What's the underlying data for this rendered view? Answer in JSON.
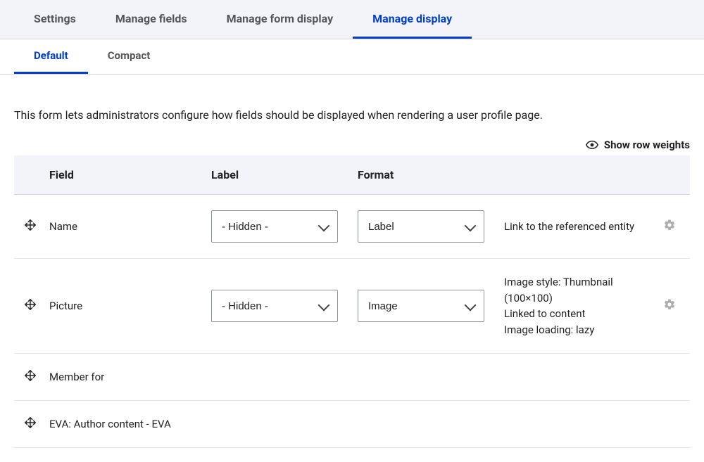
{
  "primary_tabs": [
    {
      "label": "Settings",
      "active": false
    },
    {
      "label": "Manage fields",
      "active": false
    },
    {
      "label": "Manage form display",
      "active": false
    },
    {
      "label": "Manage display",
      "active": true
    }
  ],
  "secondary_tabs": [
    {
      "label": "Default",
      "active": true
    },
    {
      "label": "Compact",
      "active": false
    }
  ],
  "description": "This form lets administrators configure how fields should be displayed when rendering a user profile page.",
  "show_row_weights": "Show row weights",
  "columns": {
    "field": "Field",
    "label": "Label",
    "format": "Format"
  },
  "rows": [
    {
      "name": "Name",
      "label_select": "- Hidden -",
      "format_select": "Label",
      "summary": [
        "Link to the referenced entity"
      ],
      "has_selects": true,
      "has_gear": true
    },
    {
      "name": "Picture",
      "label_select": "- Hidden -",
      "format_select": "Image",
      "summary": [
        "Image style: Thumbnail (100×100)",
        "Linked to content",
        "Image loading: lazy"
      ],
      "has_selects": true,
      "has_gear": true
    },
    {
      "name": "Member for",
      "has_selects": false,
      "has_gear": false
    },
    {
      "name": "EVA: Author content - EVA",
      "has_selects": false,
      "has_gear": false
    }
  ]
}
